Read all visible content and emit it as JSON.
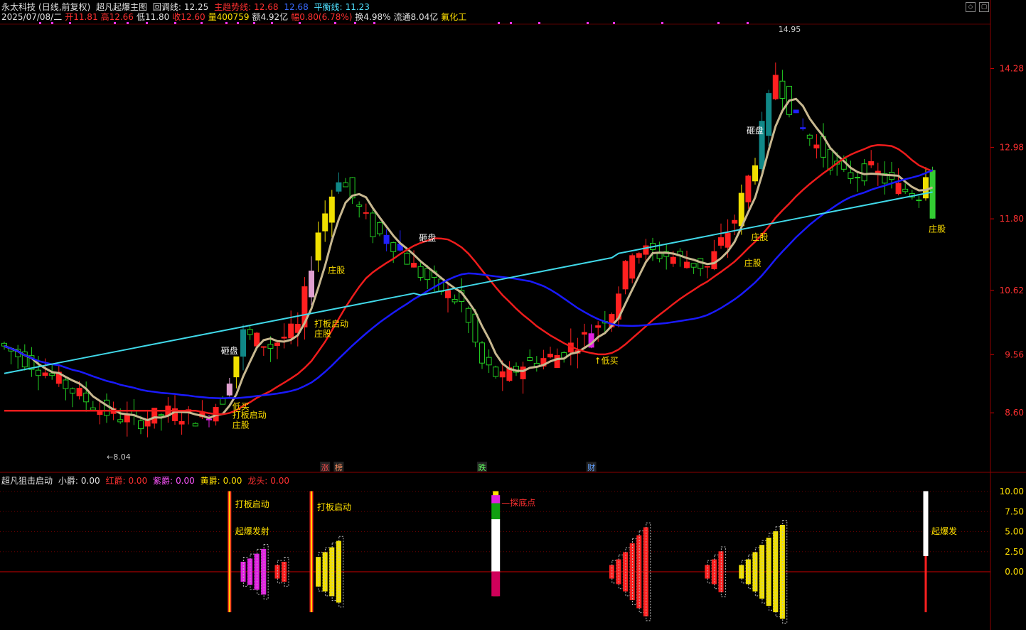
{
  "header": {
    "stock_name": "永太科技",
    "mode": "(日线,前复权)",
    "indicator_name": "超凡起爆主图",
    "huitiao_label": "回调线:",
    "huitiao_value": "12.25",
    "zhuqu_label": "主趋势线:",
    "zhuqu_value": "12.68",
    "blue_value": "12.68",
    "pingheng_label": "平衡线:",
    "pingheng_value": "11.23",
    "date": "2025/07/08/二",
    "open": "开11.81",
    "high": "高12.66",
    "low": "低11.80",
    "close": "收12.60",
    "volume": "量400759",
    "amount": "额4.92亿",
    "change": "幅0.80(6.78%)",
    "turnover": "换4.98%",
    "float": "流通8.04亿",
    "sector": "氟化工"
  },
  "sub_header": {
    "name": "超凡狙击启动",
    "small_label": "小爵:",
    "small_value": "0.00",
    "red_label": "红爵:",
    "red_value": "0.00",
    "purple_label": "紫爵:",
    "purple_value": "0.00",
    "yellow_label": "黄爵:",
    "yellow_value": "0.00",
    "dragon_label": "龙头:",
    "dragon_value": "0.00"
  },
  "colors": {
    "up": "#ff2020",
    "down": "#22cc22",
    "ma_pale": "#c8b890",
    "ma_red": "#ee1c1c",
    "ma_blue": "#1a1aff",
    "ma_cyan": "#40d8e8",
    "yellow": "#f0e000",
    "magenta": "#e020e0",
    "pink": "#e0a0d0",
    "teal": "#108888",
    "label_yellow": "#ffe000",
    "white": "#ffffff"
  },
  "chart_data": [
    {
      "type": "candlestick",
      "title": "超凡起爆主图",
      "y_ticks": [
        "14.28",
        "12.98",
        "11.80",
        "10.62",
        "9.56",
        "8.60"
      ],
      "y_tick_values": [
        14.28,
        12.98,
        11.8,
        10.62,
        9.56,
        8.6
      ],
      "ylim": [
        7.7,
        15.0
      ],
      "last_close": 12.6,
      "low_marker": "←8.04",
      "high_marker": "14.95",
      "annotations": [
        {
          "text": "砸盘",
          "bar": 62
        },
        {
          "text": "砸盘",
          "bar": 33
        },
        {
          "text": "砸盘",
          "bar": 110
        },
        {
          "text": "低买",
          "bar": 33
        },
        {
          "text": "打板启动",
          "bar": 33
        },
        {
          "text": "庄股",
          "bar": 33
        },
        {
          "text": "打板启动",
          "bar": 45
        },
        {
          "text": "庄股",
          "bar": 45
        },
        {
          "text": "庄股",
          "bar": 47
        },
        {
          "text": "↑低买",
          "bar": 86
        },
        {
          "text": "庄股",
          "bar": 109
        },
        {
          "text": "庄股",
          "bar": 108
        },
        {
          "text": "庄股",
          "bar": 135
        }
      ],
      "bottom_tags": [
        {
          "text": "涨",
          "bar": 47
        },
        {
          "text": "榜",
          "bar": 49
        },
        {
          "text": "跌",
          "bar": 70
        },
        {
          "text": "财",
          "bar": 86
        }
      ],
      "series": [
        {
          "name": "回调线",
          "value": 12.25
        },
        {
          "name": "主趋势线",
          "value": 12.68
        },
        {
          "name": "平衡线",
          "value": 11.23
        }
      ]
    },
    {
      "type": "bar",
      "title": "超凡狙击启动",
      "y_ticks": [
        "10.00",
        "7.50",
        "5.00",
        "2.50",
        "0.00"
      ],
      "y_tick_values": [
        10,
        7.5,
        5,
        2.5,
        0
      ],
      "ylim": [
        -3.5,
        11.5
      ],
      "annotations": [
        {
          "text": "打板启动",
          "bar": 33
        },
        {
          "text": "起爆发射",
          "bar": 33
        },
        {
          "text": "打板启动",
          "bar": 45
        },
        {
          "text": "探底点",
          "bar": 72
        },
        {
          "text": "起爆发",
          "bar": 135
        }
      ]
    }
  ]
}
